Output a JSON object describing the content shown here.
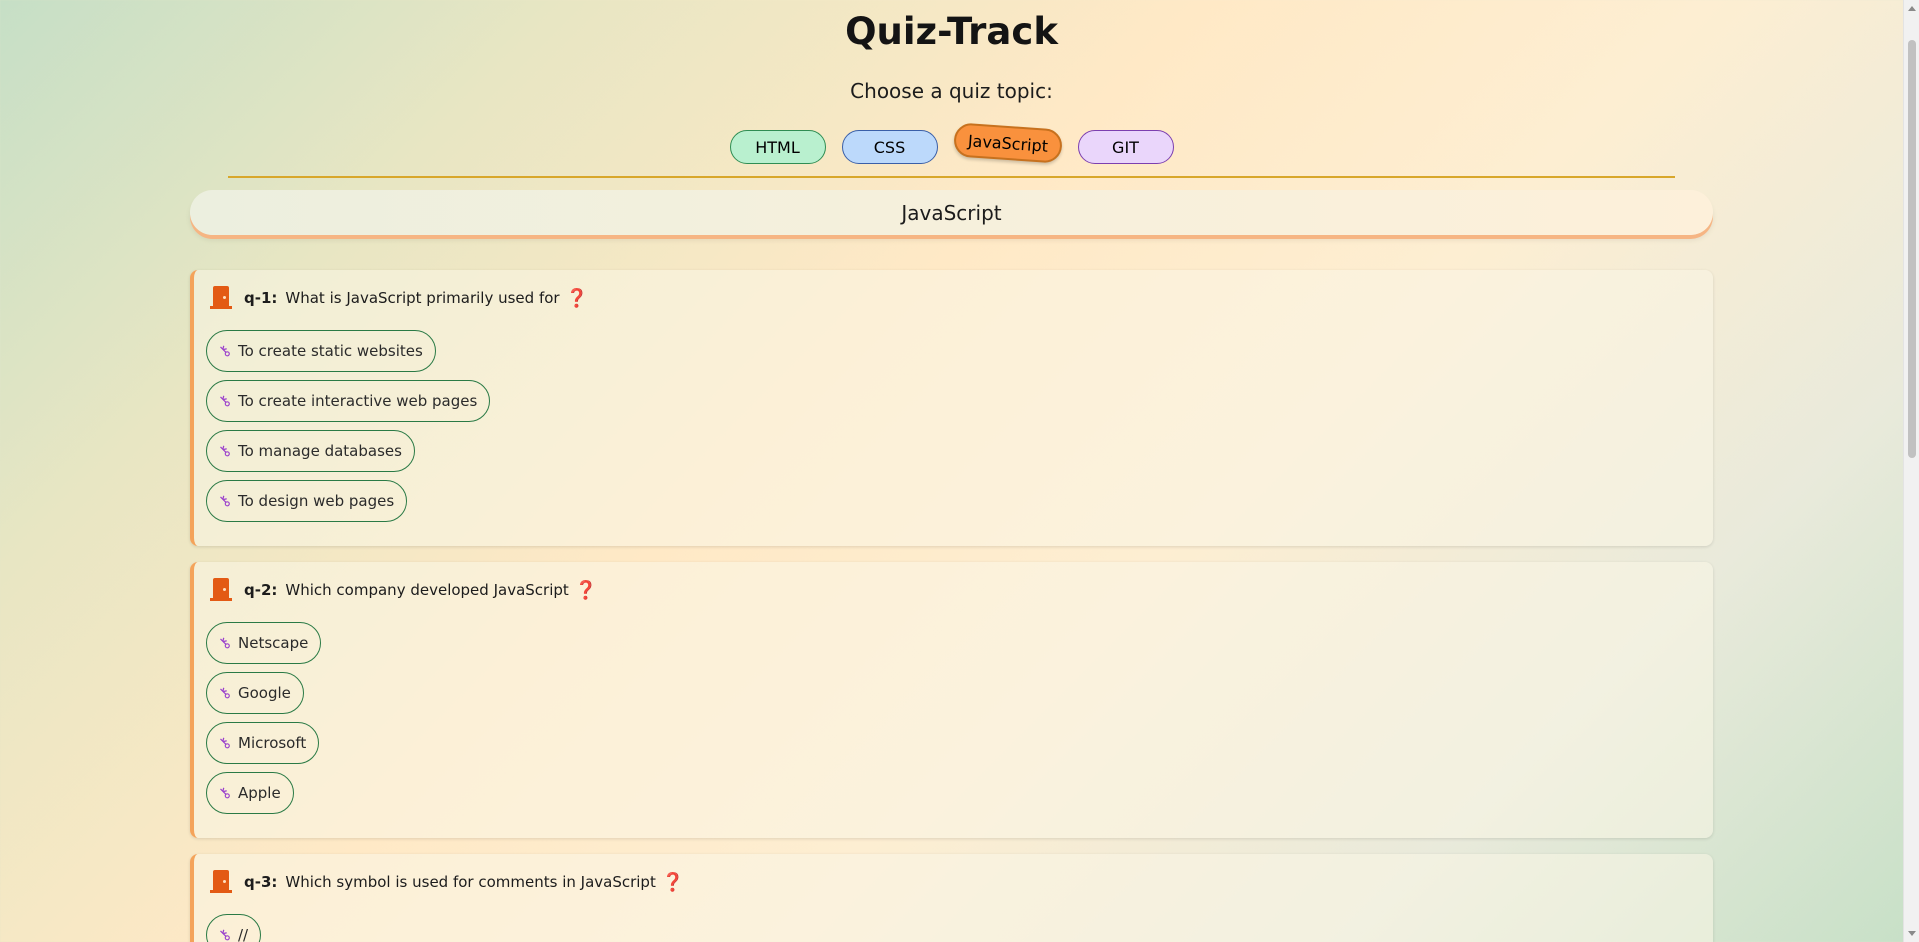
{
  "app": {
    "title": "Quiz-Track",
    "subtitle": "Choose a quiz topic:"
  },
  "topics": [
    {
      "label": "HTML",
      "color": "#b9f0cf"
    },
    {
      "label": "CSS",
      "color": "#bcd9fb"
    },
    {
      "label": "JavaScript",
      "color": "#f9913d",
      "selected": true
    },
    {
      "label": "GIT",
      "color": "#ead6fb"
    }
  ],
  "section": {
    "title": "JavaScript"
  },
  "icons": {
    "question": "door-icon",
    "answer": "key-icon",
    "help": "question-mark-icon"
  },
  "questions": [
    {
      "num": "q-1:",
      "text": "What is JavaScript primarily used for",
      "mark": "❓",
      "answers": [
        "To create static websites",
        "To create interactive web pages",
        "To manage databases",
        "To design web pages"
      ]
    },
    {
      "num": "q-2:",
      "text": "Which company developed JavaScript",
      "mark": "❓",
      "answers": [
        "Netscape",
        "Google",
        "Microsoft",
        "Apple"
      ]
    },
    {
      "num": "q-3:",
      "text": "Which symbol is used for comments in JavaScript",
      "mark": "❓",
      "answers": [
        "//"
      ]
    }
  ]
}
